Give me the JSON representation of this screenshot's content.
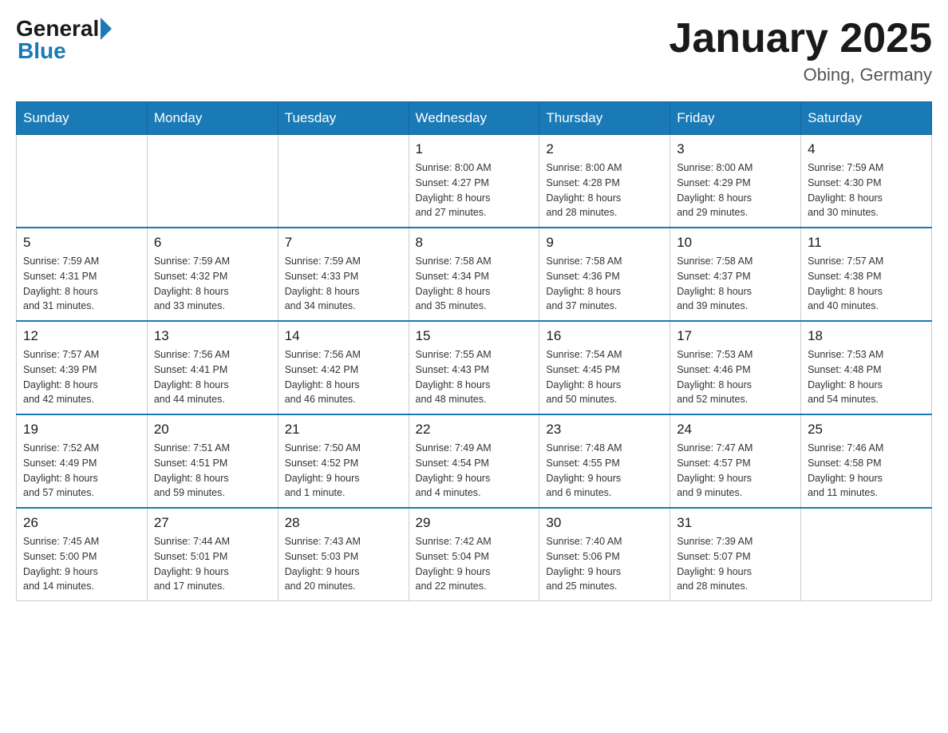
{
  "header": {
    "logo_general": "General",
    "logo_blue": "Blue",
    "title": "January 2025",
    "location": "Obing, Germany"
  },
  "days_of_week": [
    "Sunday",
    "Monday",
    "Tuesday",
    "Wednesday",
    "Thursday",
    "Friday",
    "Saturday"
  ],
  "weeks": [
    [
      {
        "day": "",
        "info": ""
      },
      {
        "day": "",
        "info": ""
      },
      {
        "day": "",
        "info": ""
      },
      {
        "day": "1",
        "info": "Sunrise: 8:00 AM\nSunset: 4:27 PM\nDaylight: 8 hours\nand 27 minutes."
      },
      {
        "day": "2",
        "info": "Sunrise: 8:00 AM\nSunset: 4:28 PM\nDaylight: 8 hours\nand 28 minutes."
      },
      {
        "day": "3",
        "info": "Sunrise: 8:00 AM\nSunset: 4:29 PM\nDaylight: 8 hours\nand 29 minutes."
      },
      {
        "day": "4",
        "info": "Sunrise: 7:59 AM\nSunset: 4:30 PM\nDaylight: 8 hours\nand 30 minutes."
      }
    ],
    [
      {
        "day": "5",
        "info": "Sunrise: 7:59 AM\nSunset: 4:31 PM\nDaylight: 8 hours\nand 31 minutes."
      },
      {
        "day": "6",
        "info": "Sunrise: 7:59 AM\nSunset: 4:32 PM\nDaylight: 8 hours\nand 33 minutes."
      },
      {
        "day": "7",
        "info": "Sunrise: 7:59 AM\nSunset: 4:33 PM\nDaylight: 8 hours\nand 34 minutes."
      },
      {
        "day": "8",
        "info": "Sunrise: 7:58 AM\nSunset: 4:34 PM\nDaylight: 8 hours\nand 35 minutes."
      },
      {
        "day": "9",
        "info": "Sunrise: 7:58 AM\nSunset: 4:36 PM\nDaylight: 8 hours\nand 37 minutes."
      },
      {
        "day": "10",
        "info": "Sunrise: 7:58 AM\nSunset: 4:37 PM\nDaylight: 8 hours\nand 39 minutes."
      },
      {
        "day": "11",
        "info": "Sunrise: 7:57 AM\nSunset: 4:38 PM\nDaylight: 8 hours\nand 40 minutes."
      }
    ],
    [
      {
        "day": "12",
        "info": "Sunrise: 7:57 AM\nSunset: 4:39 PM\nDaylight: 8 hours\nand 42 minutes."
      },
      {
        "day": "13",
        "info": "Sunrise: 7:56 AM\nSunset: 4:41 PM\nDaylight: 8 hours\nand 44 minutes."
      },
      {
        "day": "14",
        "info": "Sunrise: 7:56 AM\nSunset: 4:42 PM\nDaylight: 8 hours\nand 46 minutes."
      },
      {
        "day": "15",
        "info": "Sunrise: 7:55 AM\nSunset: 4:43 PM\nDaylight: 8 hours\nand 48 minutes."
      },
      {
        "day": "16",
        "info": "Sunrise: 7:54 AM\nSunset: 4:45 PM\nDaylight: 8 hours\nand 50 minutes."
      },
      {
        "day": "17",
        "info": "Sunrise: 7:53 AM\nSunset: 4:46 PM\nDaylight: 8 hours\nand 52 minutes."
      },
      {
        "day": "18",
        "info": "Sunrise: 7:53 AM\nSunset: 4:48 PM\nDaylight: 8 hours\nand 54 minutes."
      }
    ],
    [
      {
        "day": "19",
        "info": "Sunrise: 7:52 AM\nSunset: 4:49 PM\nDaylight: 8 hours\nand 57 minutes."
      },
      {
        "day": "20",
        "info": "Sunrise: 7:51 AM\nSunset: 4:51 PM\nDaylight: 8 hours\nand 59 minutes."
      },
      {
        "day": "21",
        "info": "Sunrise: 7:50 AM\nSunset: 4:52 PM\nDaylight: 9 hours\nand 1 minute."
      },
      {
        "day": "22",
        "info": "Sunrise: 7:49 AM\nSunset: 4:54 PM\nDaylight: 9 hours\nand 4 minutes."
      },
      {
        "day": "23",
        "info": "Sunrise: 7:48 AM\nSunset: 4:55 PM\nDaylight: 9 hours\nand 6 minutes."
      },
      {
        "day": "24",
        "info": "Sunrise: 7:47 AM\nSunset: 4:57 PM\nDaylight: 9 hours\nand 9 minutes."
      },
      {
        "day": "25",
        "info": "Sunrise: 7:46 AM\nSunset: 4:58 PM\nDaylight: 9 hours\nand 11 minutes."
      }
    ],
    [
      {
        "day": "26",
        "info": "Sunrise: 7:45 AM\nSunset: 5:00 PM\nDaylight: 9 hours\nand 14 minutes."
      },
      {
        "day": "27",
        "info": "Sunrise: 7:44 AM\nSunset: 5:01 PM\nDaylight: 9 hours\nand 17 minutes."
      },
      {
        "day": "28",
        "info": "Sunrise: 7:43 AM\nSunset: 5:03 PM\nDaylight: 9 hours\nand 20 minutes."
      },
      {
        "day": "29",
        "info": "Sunrise: 7:42 AM\nSunset: 5:04 PM\nDaylight: 9 hours\nand 22 minutes."
      },
      {
        "day": "30",
        "info": "Sunrise: 7:40 AM\nSunset: 5:06 PM\nDaylight: 9 hours\nand 25 minutes."
      },
      {
        "day": "31",
        "info": "Sunrise: 7:39 AM\nSunset: 5:07 PM\nDaylight: 9 hours\nand 28 minutes."
      },
      {
        "day": "",
        "info": ""
      }
    ]
  ]
}
